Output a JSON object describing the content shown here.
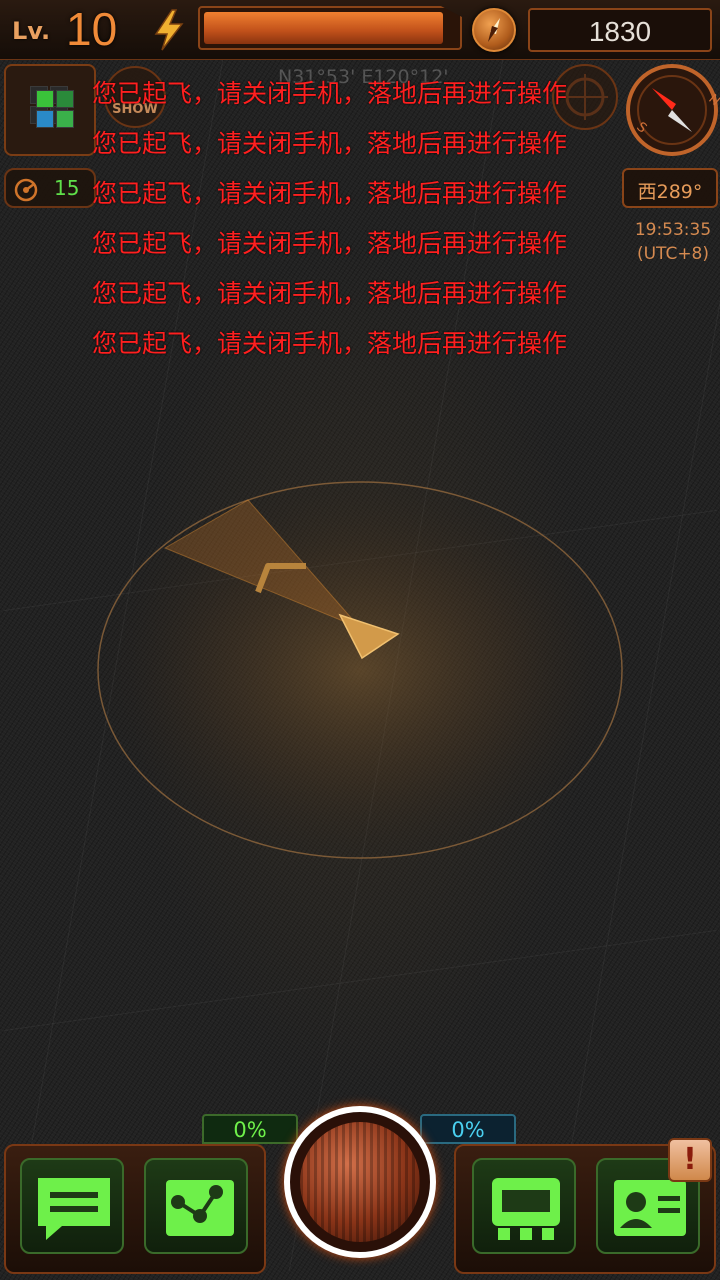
{
  "hud": {
    "level_label": "Lv.",
    "level_value": "10",
    "energy_fraction": 0.95,
    "coins": "1830"
  },
  "left_widgets": {
    "show_label": "SHOW",
    "radar_count": "15"
  },
  "location": {
    "coords": "N31°53' E120°12'",
    "heading": "西289°",
    "time": "19:53:35",
    "timezone": "(UTC+8)"
  },
  "compass": {
    "north": "N",
    "south": "S"
  },
  "warnings": [
    "您已起飞，请关闭手机，落地后再进行操作",
    "您已起飞，请关闭手机，落地后再进行操作",
    "您已起飞，请关闭手机，落地后再进行操作",
    "您已起飞，请关闭手机，落地后再进行操作",
    "您已起飞，请关闭手机，落地后再进行操作",
    "您已起飞，请关闭手机，落地后再进行操作"
  ],
  "bottom": {
    "left_percent": "0%",
    "right_percent": "0%",
    "alert": "!"
  },
  "colors": {
    "warning_text": "#ff1f1f",
    "accent_orange": "#f08a38",
    "button_green": "#6ef04a",
    "cyan": "#4ad0f0"
  },
  "icons": [
    "lightning-icon",
    "compass-coin-icon",
    "grid-menu-icon",
    "radar-icon",
    "target-icon",
    "chat-icon",
    "share-icon",
    "shop-icon",
    "profile-card-icon"
  ]
}
